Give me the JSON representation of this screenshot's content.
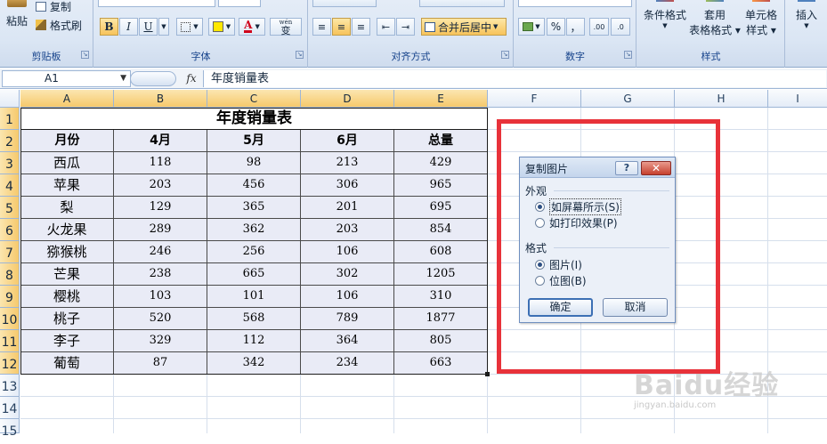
{
  "ribbon": {
    "paste_label": "粘贴",
    "copy_label": "复制",
    "format_painter_label": "格式刷",
    "clipboard_group": "剪贴板",
    "font_group": "字体",
    "alignment_group": "对齐方式",
    "number_group": "数字",
    "styles_group": "样式",
    "merge_center_label": "合并后居中",
    "conditional_format_label": "条件格式",
    "table_format_label_1": "套用",
    "table_format_label_2": "表格格式",
    "cell_styles_label_1": "单元格",
    "cell_styles_label_2": "样式",
    "insert_label": "插入",
    "bold_label": "B",
    "italic_label": "I",
    "underline_label": "U",
    "phonetic_label": "wén",
    "phonetic_sub": "变",
    "percent_label": "%",
    "comma_label": "，",
    "inc_decimal_label": ".00",
    "dec_decimal_label": ".0"
  },
  "formula_bar": {
    "name_box": "A1",
    "fx_label": "fx",
    "content": "年度销量表"
  },
  "columns": [
    "A",
    "B",
    "C",
    "D",
    "E",
    "F",
    "G",
    "H",
    "I"
  ],
  "rows": [
    "1",
    "2",
    "3",
    "4",
    "5",
    "6",
    "7",
    "8",
    "9",
    "10",
    "11",
    "12",
    "13",
    "14",
    "15"
  ],
  "sheet": {
    "title": "年度销量表",
    "headers": [
      "月份",
      "4月",
      "5月",
      "6月",
      "总量"
    ],
    "data": [
      [
        "西瓜",
        "118",
        "98",
        "213",
        "429"
      ],
      [
        "苹果",
        "203",
        "456",
        "306",
        "965"
      ],
      [
        "梨",
        "129",
        "365",
        "201",
        "695"
      ],
      [
        "火龙果",
        "289",
        "362",
        "203",
        "854"
      ],
      [
        "猕猴桃",
        "246",
        "256",
        "106",
        "608"
      ],
      [
        "芒果",
        "238",
        "665",
        "302",
        "1205"
      ],
      [
        "樱桃",
        "103",
        "101",
        "106",
        "310"
      ],
      [
        "桃子",
        "520",
        "568",
        "789",
        "1877"
      ],
      [
        "李子",
        "329",
        "112",
        "364",
        "805"
      ],
      [
        "葡萄",
        "87",
        "342",
        "234",
        "663"
      ]
    ]
  },
  "dialog": {
    "title": "复制图片",
    "help": "?",
    "close": "✕",
    "appearance_label": "外观",
    "opt_screen": "如屏幕所示(S)",
    "opt_print": "如打印效果(P)",
    "format_label": "格式",
    "opt_picture": "图片(I)",
    "opt_bitmap": "位图(B)",
    "ok": "确定",
    "cancel": "取消"
  },
  "watermark": {
    "text": "Baidu经验",
    "url": "jingyan.baidu.com"
  },
  "colors": {
    "highlight": "#e8323a",
    "table_fill": "#e9ebf6",
    "selected_header": "#f6c96c"
  }
}
